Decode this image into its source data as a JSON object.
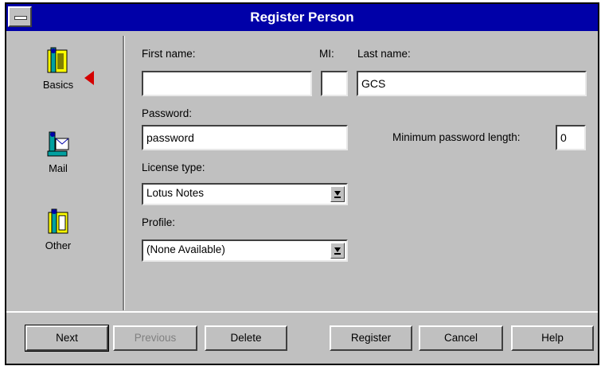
{
  "window": {
    "title": "Register Person"
  },
  "nav": {
    "items": [
      {
        "label": "Basics",
        "icon": "person-basics-icon"
      },
      {
        "label": "Mail",
        "icon": "mail-icon"
      },
      {
        "label": "Other",
        "icon": "other-icon"
      }
    ],
    "selected_indicator": "red-arrow-icon"
  },
  "form": {
    "first_name": {
      "label": "First name:",
      "value": ""
    },
    "mi": {
      "label": "MI:",
      "value": ""
    },
    "last_name": {
      "label": "Last name:",
      "value": "GCS"
    },
    "password": {
      "label": "Password:",
      "value": "password"
    },
    "min_password_length": {
      "label": "Minimum password length:",
      "value": "0"
    },
    "license_type": {
      "label": "License type:",
      "value": "Lotus Notes"
    },
    "profile": {
      "label": "Profile:",
      "value": "(None Available)"
    }
  },
  "buttons": {
    "next": "Next",
    "previous": "Previous",
    "delete": "Delete",
    "register": "Register",
    "cancel": "Cancel",
    "help": "Help"
  },
  "colors": {
    "titlebar": "#0000a8",
    "face": "#c0c0c0",
    "indicator": "#d40000"
  }
}
